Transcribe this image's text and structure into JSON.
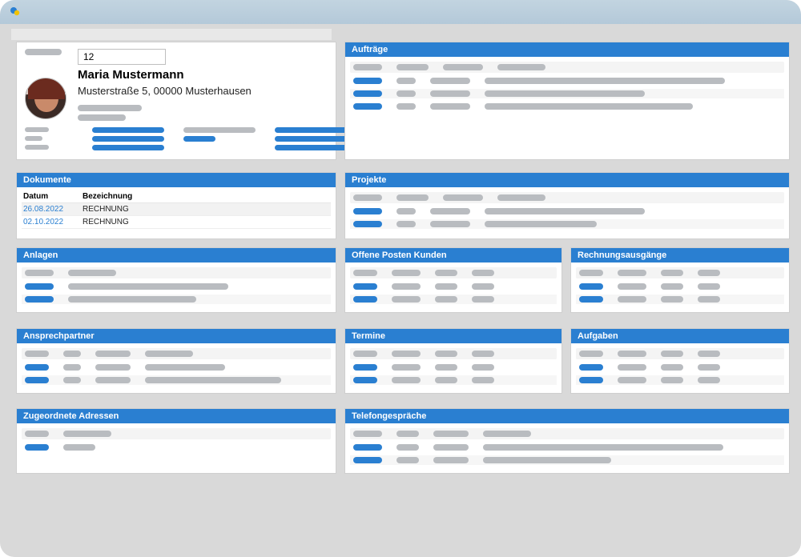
{
  "customer": {
    "id_value": "12",
    "name": "Maria Mustermann",
    "address": "Musterstraße 5, 00000 Musterhausen"
  },
  "panels": {
    "auftraege": {
      "title": "Aufträge"
    },
    "dokumente": {
      "title": "Dokumente",
      "col_date": "Datum",
      "col_desc": "Bezeichnung",
      "rows": [
        {
          "date": "26.08.2022",
          "desc": "RECHNUNG"
        },
        {
          "date": "02.10.2022",
          "desc": "RECHNUNG"
        }
      ]
    },
    "projekte": {
      "title": "Projekte"
    },
    "anlagen": {
      "title": "Anlagen"
    },
    "offene": {
      "title": "Offene Posten Kunden"
    },
    "rechnung": {
      "title": "Rechnungsausgänge"
    },
    "ansprech": {
      "title": "Ansprechpartner"
    },
    "termine": {
      "title": "Termine"
    },
    "aufgaben": {
      "title": "Aufgaben"
    },
    "zugeord": {
      "title": "Zugeordnete Adressen"
    },
    "telefon": {
      "title": "Telefongespräche"
    }
  }
}
